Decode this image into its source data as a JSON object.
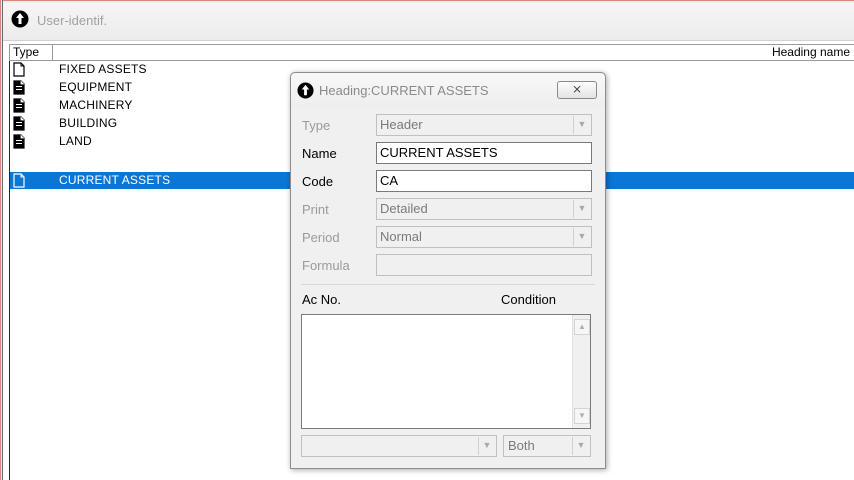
{
  "window": {
    "title": "User-identif."
  },
  "list": {
    "columns": {
      "type": "Type",
      "heading": "Heading name"
    },
    "rows": [
      {
        "label": "FIXED ASSETS",
        "icon": "document-outline-icon"
      },
      {
        "label": "EQUIPMENT",
        "icon": "document-icon"
      },
      {
        "label": "MACHINERY",
        "icon": "document-icon"
      },
      {
        "label": "BUILDING",
        "icon": "document-icon"
      },
      {
        "label": "LAND",
        "icon": "document-icon"
      },
      {
        "label": "CURRENT ASSETS",
        "icon": "document-outline-icon",
        "selected": true
      }
    ]
  },
  "dialog": {
    "title": "Heading:CURRENT ASSETS",
    "close_label": "⨯",
    "fields": {
      "type": {
        "label": "Type",
        "value": "Header",
        "disabled": true
      },
      "name": {
        "label": "Name",
        "value": "CURRENT ASSETS"
      },
      "code": {
        "label": "Code",
        "value": "CA"
      },
      "print": {
        "label": "Print",
        "value": "Detailed",
        "disabled": true
      },
      "period": {
        "label": "Period",
        "value": "Normal",
        "disabled": true
      },
      "formula": {
        "label": "Formula",
        "value": "",
        "disabled": true
      }
    },
    "columns": {
      "ac_no": "Ac No.",
      "condition": "Condition"
    },
    "bottom": {
      "left_value": "",
      "right_value": "Both"
    }
  },
  "colors": {
    "selection": "#0a76d6",
    "frame_accent": "#d6867a"
  }
}
